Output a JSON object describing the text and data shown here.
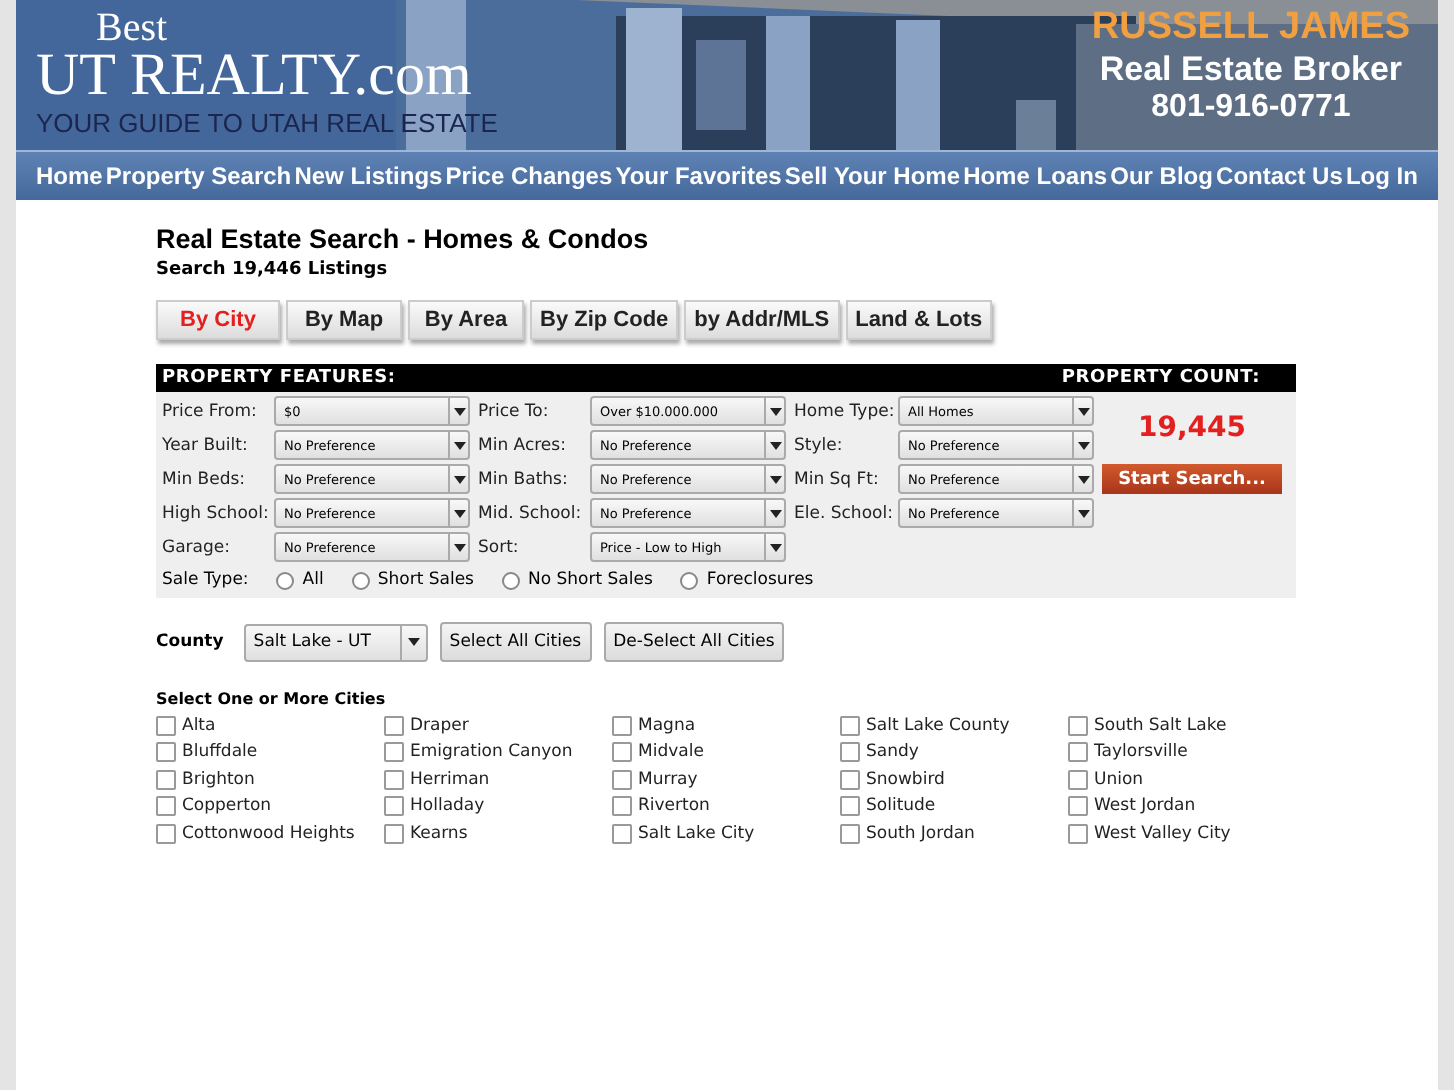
{
  "header": {
    "logo_top": "Best",
    "logo_main": "UT REALTY.com",
    "tagline": "YOUR GUIDE TO UTAH REAL ESTATE",
    "agent_name": "RUSSELL JAMES",
    "agent_title": "Real Estate Broker",
    "agent_phone": "801-916-0771"
  },
  "nav": [
    "Home",
    "Property Search",
    "New Listings",
    "Price Changes",
    "Your Favorites",
    "Sell Your Home",
    "Home Loans",
    "Our Blog",
    "Contact Us",
    "Log In"
  ],
  "title": "Real Estate Search - Homes & Condos",
  "subtitle": "Search 19,446 Listings",
  "tabs": [
    {
      "label": "By City",
      "selected": true
    },
    {
      "label": "By Map",
      "selected": false
    },
    {
      "label": "By Area",
      "selected": false
    },
    {
      "label": "By Zip Code",
      "selected": false
    },
    {
      "label": "by Addr/MLS",
      "selected": false
    },
    {
      "label": "Land & Lots",
      "selected": false
    }
  ],
  "features": {
    "heading": "PROPERTY FEATURES:",
    "count_heading": "PROPERTY COUNT:",
    "count": "19,445",
    "search_button": "Start Search...",
    "fields": [
      {
        "label": "Price From:",
        "value": "$0"
      },
      {
        "label": "Price To:",
        "value": "Over $10.000.000"
      },
      {
        "label": "Home Type:",
        "value": "All Homes"
      },
      {
        "label": "Year Built:",
        "value": "No Preference"
      },
      {
        "label": "Min Acres:",
        "value": "No Preference"
      },
      {
        "label": "Style:",
        "value": "No Preference"
      },
      {
        "label": "Min Beds:",
        "value": "No Preference"
      },
      {
        "label": "Min Baths:",
        "value": "No Preference"
      },
      {
        "label": "Min Sq Ft:",
        "value": "No Preference"
      },
      {
        "label": "High School:",
        "value": "No Preference"
      },
      {
        "label": "Mid. School:",
        "value": "No Preference"
      },
      {
        "label": "Ele. School:",
        "value": "No Preference"
      },
      {
        "label": "Garage:",
        "value": "No Preference"
      },
      {
        "label": "Sort:",
        "value": "Price - Low to High"
      }
    ],
    "sale_type": {
      "label": "Sale Type:",
      "options": [
        {
          "label": "All",
          "selected": false
        },
        {
          "label": "Short Sales",
          "selected": false
        },
        {
          "label": "No Short Sales",
          "selected": false
        },
        {
          "label": "Foreclosures",
          "selected": false
        }
      ]
    }
  },
  "county": {
    "label": "County",
    "value": "Salt Lake - UT",
    "buttons": [
      "Select All Cities",
      "De-Select All Cities"
    ]
  },
  "cities": {
    "heading": "Select One or More Cities",
    "items": [
      {
        "label": "Alta",
        "checked": false
      },
      {
        "label": "Bluffdale",
        "checked": false
      },
      {
        "label": "Brighton",
        "checked": false
      },
      {
        "label": "Copperton",
        "checked": false
      },
      {
        "label": "Cottonwood Heights",
        "checked": false
      },
      {
        "label": "Draper",
        "checked": false
      },
      {
        "label": "Emigration Canyon",
        "checked": false
      },
      {
        "label": "Herriman",
        "checked": false
      },
      {
        "label": "Holladay",
        "checked": false
      },
      {
        "label": "Kearns",
        "checked": false
      },
      {
        "label": "Magna",
        "checked": false
      },
      {
        "label": "Midvale",
        "checked": false
      },
      {
        "label": "Murray",
        "checked": false
      },
      {
        "label": "Riverton",
        "checked": false
      },
      {
        "label": "Salt Lake City",
        "checked": false
      },
      {
        "label": "Salt Lake County",
        "checked": false
      },
      {
        "label": "Sandy",
        "checked": false
      },
      {
        "label": "Snowbird",
        "checked": false
      },
      {
        "label": "Solitude",
        "checked": false
      },
      {
        "label": "South Jordan",
        "checked": false
      },
      {
        "label": "South Salt Lake",
        "checked": false
      },
      {
        "label": "Taylorsville",
        "checked": false
      },
      {
        "label": "Union",
        "checked": false
      },
      {
        "label": "West Jordan",
        "checked": false
      },
      {
        "label": "West Valley City",
        "checked": false
      }
    ]
  }
}
